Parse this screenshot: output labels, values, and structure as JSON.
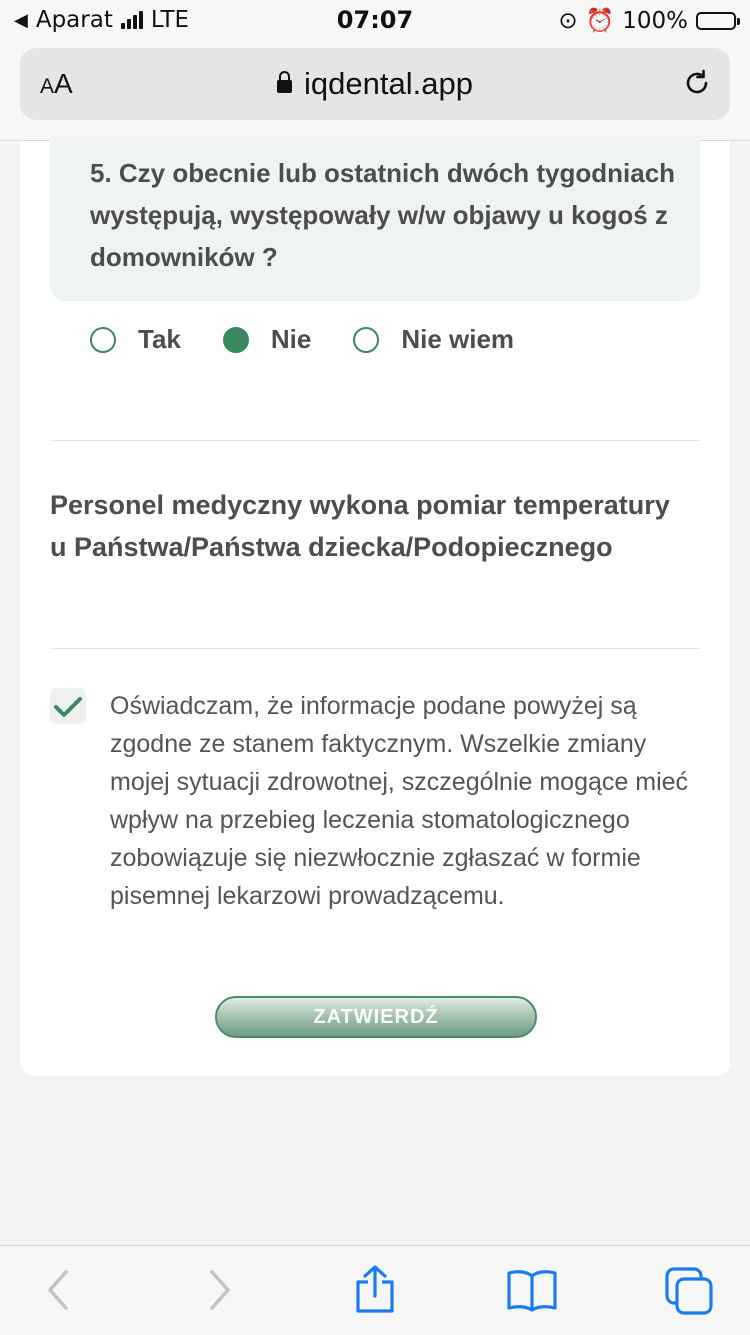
{
  "status_bar": {
    "back_app": "Aparat",
    "network": "LTE",
    "time": "07:07",
    "battery": "100%"
  },
  "browser": {
    "text_size_label": "AA",
    "url": "iqdental.app"
  },
  "question": {
    "text": "5. Czy obecnie lub ostatnich dwóch tygodniach występują, występowały w/w objawy u kogoś z domowników ?",
    "options": [
      "Tak",
      "Nie",
      "Nie wiem"
    ],
    "selected": "Nie"
  },
  "temperature_note": "Personel medyczny wykona pomiar temperatury u Państwa/Państwa dziecka/Podopiecznego",
  "consent": {
    "checked": true,
    "text": "Oświadczam, że informacje podane powyżej są zgodne ze stanem faktycznym. Wszelkie zmiany mojej sytuacji zdrowotnej, szczególnie mogące mieć wpływ na przebieg leczenia stomatologicznego zobowiązuje się niezwłocznie zgłaszać w formie pisemnej lekarzowi prowadzącemu."
  },
  "submit_label": "ZATWIERDŹ",
  "colors": {
    "accent": "#3b8a5f",
    "ios_blue": "#1a7cf5"
  }
}
